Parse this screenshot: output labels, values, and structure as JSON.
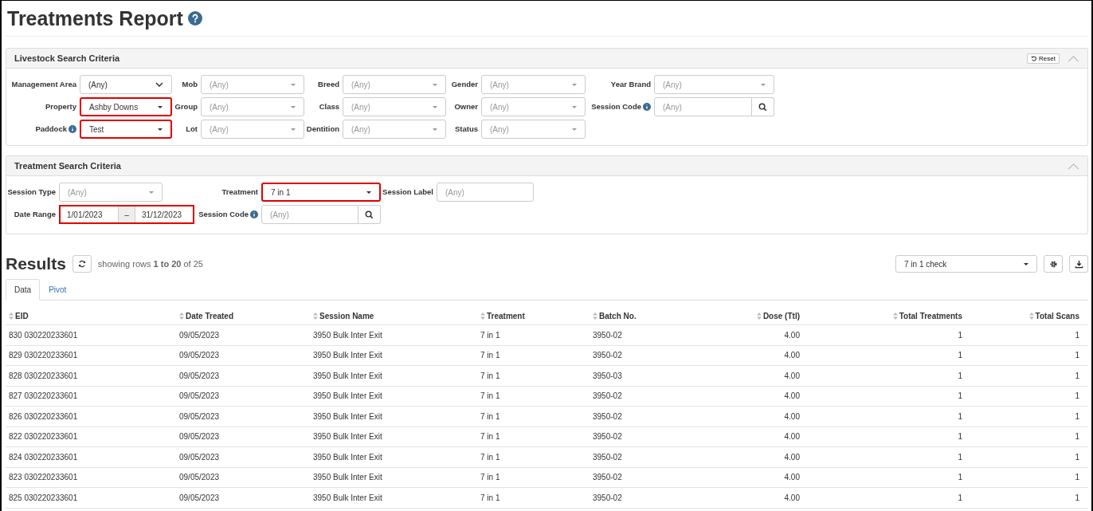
{
  "page": {
    "title": "Treatments Report"
  },
  "livestock_criteria": {
    "title": "Livestock Search Criteria",
    "reset_button": "Reset",
    "expanded": true,
    "fields": [
      {
        "label": "Management Area",
        "kind": "select",
        "value": "(Any)",
        "highlighted": false,
        "info": false
      },
      {
        "label": "Mob",
        "kind": "combo",
        "placeholder": "(Any)",
        "highlighted": false,
        "info": false
      },
      {
        "label": "Breed",
        "kind": "combo",
        "placeholder": "(Any)",
        "highlighted": false,
        "info": false
      },
      {
        "label": "Gender",
        "kind": "combo",
        "placeholder": "(Any)",
        "highlighted": false,
        "info": false
      },
      {
        "label": "Year Brand",
        "kind": "combo",
        "placeholder": "(Any)",
        "highlighted": false,
        "info": false
      },
      {
        "label": "Property",
        "kind": "combo",
        "value": "Ashby Downs",
        "highlighted": true,
        "info": false
      },
      {
        "label": "Group",
        "kind": "combo",
        "placeholder": "(Any)",
        "highlighted": false,
        "info": false
      },
      {
        "label": "Class",
        "kind": "combo",
        "placeholder": "(Any)",
        "highlighted": false,
        "info": false
      },
      {
        "label": "Owner",
        "kind": "combo",
        "placeholder": "(Any)",
        "highlighted": false,
        "info": false
      },
      {
        "label": "Session Code",
        "kind": "search",
        "placeholder": "(Any)",
        "highlighted": false,
        "info": true
      },
      {
        "label": "Paddock",
        "kind": "combo",
        "value": "Test",
        "highlighted": true,
        "info": true
      },
      {
        "label": "Lot",
        "kind": "combo",
        "placeholder": "(Any)",
        "highlighted": false,
        "info": false
      },
      {
        "label": "Dentition",
        "kind": "combo",
        "placeholder": "(Any)",
        "highlighted": false,
        "info": false
      },
      {
        "label": "Status",
        "kind": "combo",
        "placeholder": "(Any)",
        "highlighted": false,
        "info": false
      }
    ]
  },
  "treatment_criteria": {
    "title": "Treatment Search Criteria",
    "expanded": true,
    "fields": [
      {
        "label": "Session Type",
        "kind": "combo",
        "placeholder": "(Any)",
        "highlighted": false,
        "info": false
      },
      {
        "label": "Treatment",
        "kind": "combo",
        "value": "7 in 1",
        "highlighted": true,
        "info": false
      },
      {
        "label": "Session Label",
        "kind": "text",
        "placeholder": "(Any)",
        "highlighted": false,
        "info": false
      },
      {
        "label": "Date Range",
        "kind": "daterange",
        "from": "1/01/2023",
        "separator": "–",
        "to": "31/12/2023",
        "highlighted": true,
        "info": false
      },
      {
        "label": "Session Code",
        "kind": "search",
        "placeholder": "(Any)",
        "highlighted": false,
        "info": true
      }
    ]
  },
  "results": {
    "title": "Results",
    "summary": "showing rows **1 to 20** of 25",
    "view_select": "7 in 1 check",
    "tabs": [
      {
        "label": "Data",
        "selected": true
      },
      {
        "label": "Pivot",
        "selected": false
      }
    ],
    "table": {
      "columns": [
        {
          "label": "EID",
          "kind": "text"
        },
        {
          "label": "Date Treated",
          "kind": "text"
        },
        {
          "label": "Session Name",
          "kind": "text"
        },
        {
          "label": "Treatment",
          "kind": "text"
        },
        {
          "label": "Batch No.",
          "kind": "text"
        },
        {
          "label": "Dose (Ttl)",
          "kind": "number"
        },
        {
          "label": "Total Treatments",
          "kind": "number"
        },
        {
          "label": "Total Scans",
          "kind": "number"
        }
      ],
      "rows": [
        [
          "830 030220233601",
          "09/05/2023",
          "3950 Bulk Inter Exit",
          "7 in 1",
          "3950-02",
          "4.00",
          "1",
          "1"
        ],
        [
          "829 030220233601",
          "09/05/2023",
          "3950 Bulk Inter Exit",
          "7 in 1",
          "3950-02",
          "4.00",
          "1",
          "1"
        ],
        [
          "828 030220233601",
          "09/05/2023",
          "3950 Bulk Inter Exit",
          "7 in 1",
          "3950-03",
          "4.00",
          "1",
          "1"
        ],
        [
          "827 030220233601",
          "09/05/2023",
          "3950 Bulk Inter Exit",
          "7 in 1",
          "3950-02",
          "4.00",
          "1",
          "1"
        ],
        [
          "826 030220233601",
          "09/05/2023",
          "3950 Bulk Inter Exit",
          "7 in 1",
          "3950-02",
          "4.00",
          "1",
          "1"
        ],
        [
          "822 030220233601",
          "09/05/2023",
          "3950 Bulk Inter Exit",
          "7 in 1",
          "3950-02",
          "4.00",
          "1",
          "1"
        ],
        [
          "824 030220233601",
          "09/05/2023",
          "3950 Bulk Inter Exit",
          "7 in 1",
          "3950-02",
          "4.00",
          "1",
          "1"
        ],
        [
          "823 030220233601",
          "09/05/2023",
          "3950 Bulk Inter Exit",
          "7 in 1",
          "3950-02",
          "4.00",
          "1",
          "1"
        ],
        [
          "825 030220233601",
          "09/05/2023",
          "3950 Bulk Inter Exit",
          "7 in 1",
          "3950-02",
          "4.00",
          "1",
          "1"
        ]
      ]
    }
  }
}
